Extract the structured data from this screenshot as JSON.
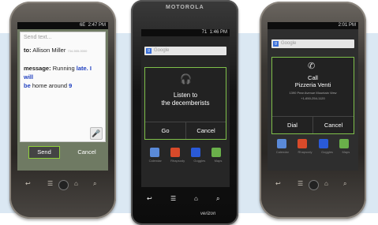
{
  "phone1": {
    "status": {
      "carrier": "6E",
      "time": "2:47 PM"
    },
    "message_ui": {
      "placeholder": "Send text...",
      "to_label": "to:",
      "recipient": "Allison Miller",
      "number": "734-555-0000",
      "message_label": "message:",
      "message_words": [
        "Running",
        "late.",
        "I will",
        "be",
        "home around",
        "9"
      ],
      "send_button": "Send",
      "cancel_button": "Cancel"
    }
  },
  "phone2": {
    "brand": "MOTOROLA",
    "bottom_brand": "verizon",
    "status": {
      "signal": "71",
      "time": "1:46 PM"
    },
    "search_hint": "Google",
    "dialog": {
      "title": "Listen to",
      "subtitle": "the decemberists",
      "go_button": "Go",
      "cancel_button": "Cancel"
    },
    "dock_labels": [
      "Calendar",
      "Rhapsody",
      "Goggles",
      "Maps"
    ]
  },
  "phone3": {
    "status": {
      "time": "2:01 PM"
    },
    "search_hint": "Google",
    "dialog": {
      "title": "Call",
      "place": "Pizzeria Venti",
      "address": "1390 Pear Avenue Mountain View",
      "phone": "+1-650-254-1120",
      "dial_button": "Dial",
      "cancel_button": "Cancel"
    },
    "dock_labels": [
      "Calendar",
      "Rhapsody",
      "Goggles",
      "Maps"
    ]
  },
  "colors": {
    "highlight": "#8fd03a",
    "accent_blue": "#2040c0",
    "band": "#dbe8f3"
  }
}
